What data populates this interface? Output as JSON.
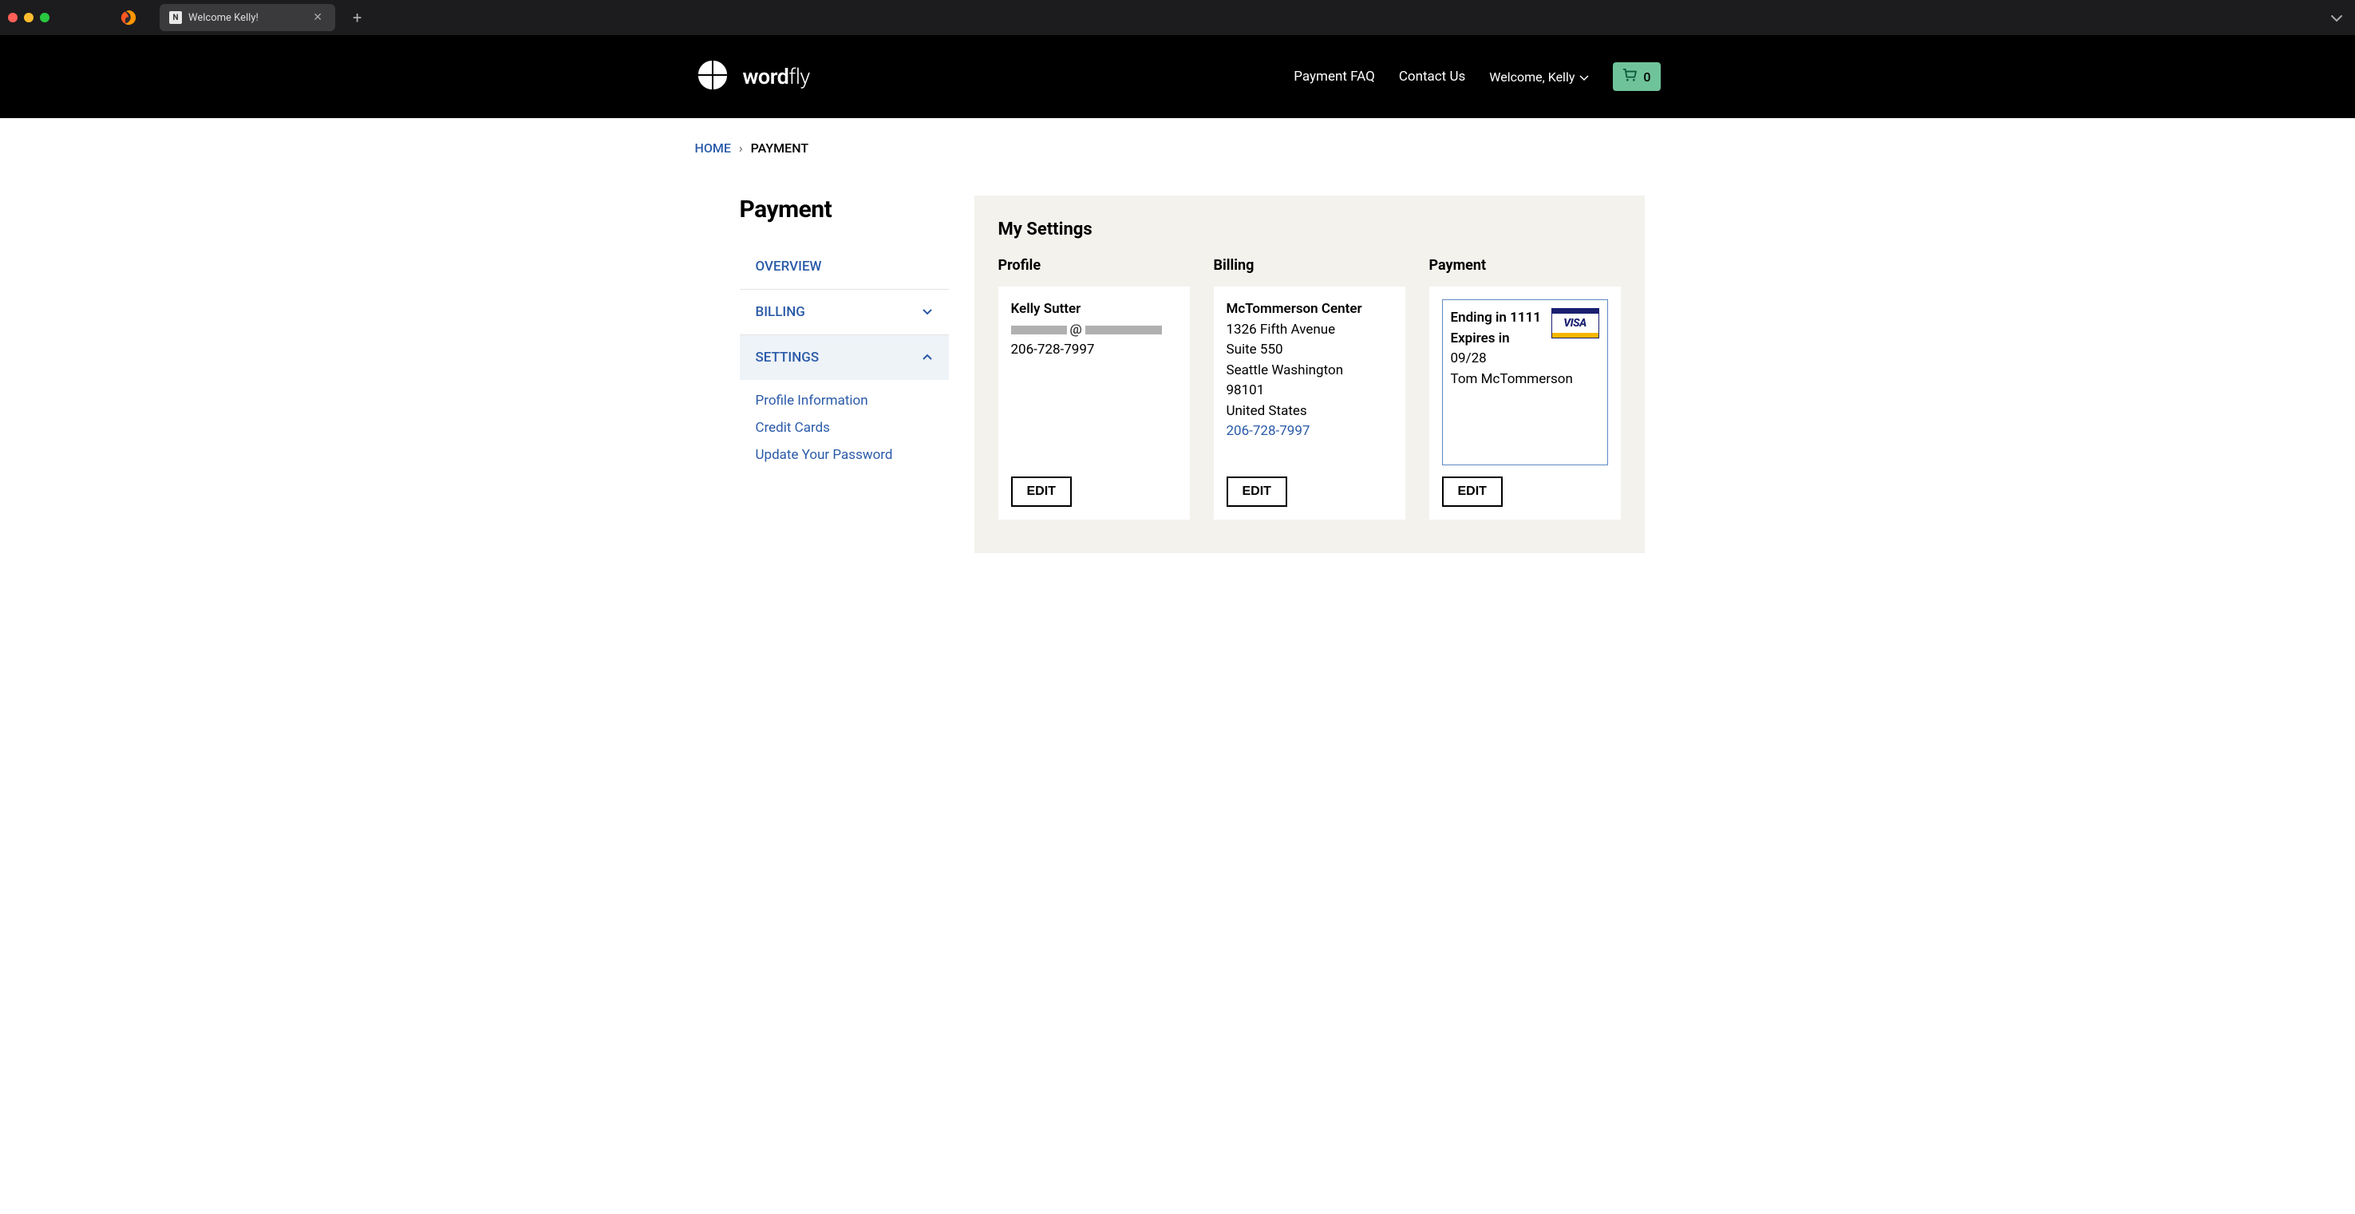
{
  "browser": {
    "tab_title": "Welcome Kelly!"
  },
  "header": {
    "brand_word": "word",
    "brand_fly": "fly",
    "nav_payment_faq": "Payment FAQ",
    "nav_contact_us": "Contact Us",
    "welcome_label": "Welcome, Kelly",
    "cart_count": "0"
  },
  "breadcrumb": {
    "home": "HOME",
    "current": "PAYMENT"
  },
  "sidebar": {
    "title": "Payment",
    "overview": "OVERVIEW",
    "billing": "BILLING",
    "settings": "SETTINGS",
    "sub_profile": "Profile Information",
    "sub_credit_cards": "Credit Cards",
    "sub_update_password": "Update Your Password"
  },
  "panel": {
    "heading": "My Settings",
    "profile_label": "Profile",
    "billing_label": "Billing",
    "payment_label": "Payment",
    "edit_label": "EDIT"
  },
  "profile": {
    "name": "Kelly Sutter",
    "email_at": "@",
    "phone": "206-728-7997"
  },
  "billing": {
    "org": "McTommerson Center",
    "line1": "1326 Fifth Avenue",
    "line2": "Suite 550",
    "city_state": "Seattle Washington",
    "zip": "98101",
    "country": "United States",
    "phone": "206-728-7997"
  },
  "payment": {
    "ending_label": "Ending in ",
    "ending_value": "1111",
    "expires_label": "Expires in",
    "expires_value": "09/28",
    "cardholder": "Tom McTommerson",
    "card_brand": "VISA"
  }
}
